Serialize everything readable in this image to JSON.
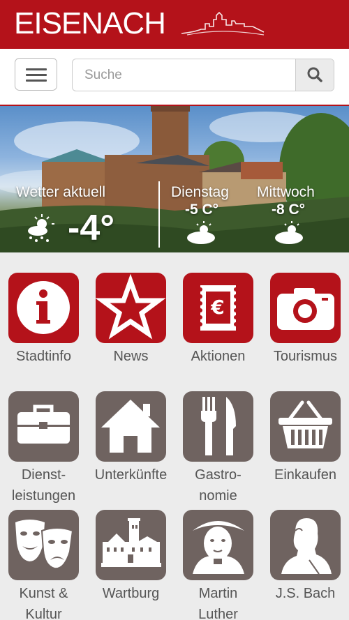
{
  "header": {
    "brand": "EISENACH",
    "logo_icon": "castle-outline-icon",
    "background": "#b4121a"
  },
  "nav": {
    "menu_icon": "hamburger-icon",
    "search": {
      "placeholder": "Suche",
      "value": "",
      "icon": "search-icon"
    }
  },
  "weather": {
    "current": {
      "label": "Wetter aktuell",
      "temp": "-4°",
      "icon": "snow-sun-icon"
    },
    "forecast": [
      {
        "day": "Dienstag",
        "temp": "-5 C°",
        "icon": "partly-cloudy-icon"
      },
      {
        "day": "Mittwoch",
        "temp": "-8 C°",
        "icon": "partly-cloudy-icon"
      }
    ]
  },
  "tiles": [
    {
      "label": "Stadtinfo",
      "icon": "info-icon",
      "color": "#b4121a"
    },
    {
      "label": "News",
      "icon": "star-icon",
      "color": "#b4121a"
    },
    {
      "label": "Aktionen",
      "icon": "euro-stamp-icon",
      "color": "#b4121a"
    },
    {
      "label": "Tourismus",
      "icon": "camera-icon",
      "color": "#b4121a"
    },
    {
      "label_lines": [
        "Dienst-",
        "leistungen"
      ],
      "icon": "briefcase-icon",
      "color": "#6f6360"
    },
    {
      "label": "Unterkünfte",
      "icon": "house-icon",
      "color": "#6f6360"
    },
    {
      "label_lines": [
        "Gastro-",
        "nomie"
      ],
      "icon": "fork-knife-icon",
      "color": "#6f6360"
    },
    {
      "label": "Einkaufen",
      "icon": "basket-icon",
      "color": "#6f6360"
    },
    {
      "label_lines": [
        "Kunst &",
        "Kultur"
      ],
      "icon": "theater-masks-icon",
      "color": "#6f6360"
    },
    {
      "label": "Wartburg",
      "icon": "castle-icon",
      "color": "#6f6360"
    },
    {
      "label_lines": [
        "Martin",
        "Luther"
      ],
      "icon": "luther-portrait-icon",
      "color": "#6f6360"
    },
    {
      "label": "J.S. Bach",
      "icon": "bach-bust-icon",
      "color": "#6f6360"
    }
  ]
}
